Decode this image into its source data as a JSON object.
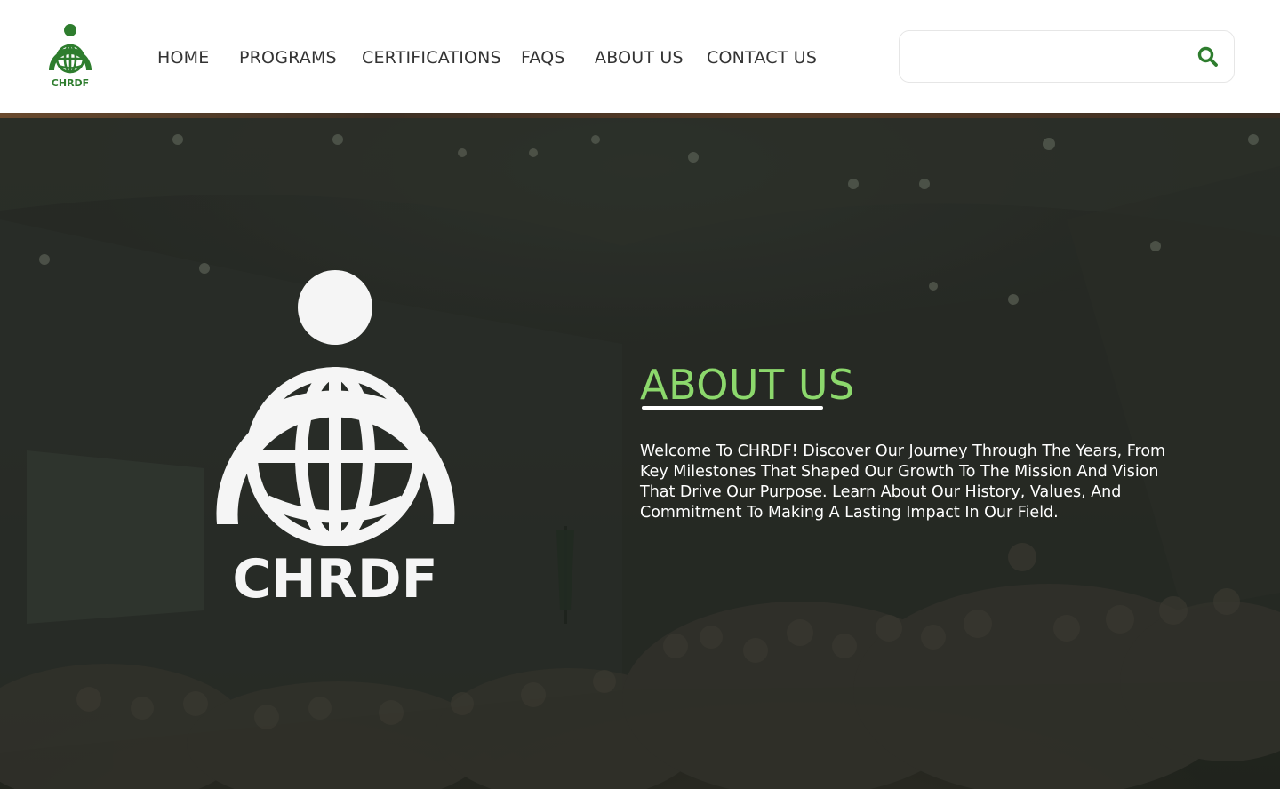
{
  "brand": {
    "name": "CHRDF",
    "green": "#2e7d2e",
    "accent_light_green": "#8cd86c"
  },
  "nav": {
    "items": [
      {
        "label": "HOME"
      },
      {
        "label": "PROGRAMS"
      },
      {
        "label": "CERTIFICATIONS"
      },
      {
        "label": "FAQS"
      },
      {
        "label": "ABOUT US"
      },
      {
        "label": "CONTACT US"
      }
    ]
  },
  "search": {
    "placeholder": "",
    "value": "",
    "icon": "search-icon"
  },
  "hero": {
    "logo_text": "CHRDF",
    "title": "ABOUT US",
    "description": "Welcome To CHRDF! Discover Our Journey Through The Years, From Key Milestones That Shaped Our Growth To The Mission And Vision That Drive Our Purpose. Learn About Our History, Values, And Commitment To Making A Lasting Impact In Our Field."
  }
}
